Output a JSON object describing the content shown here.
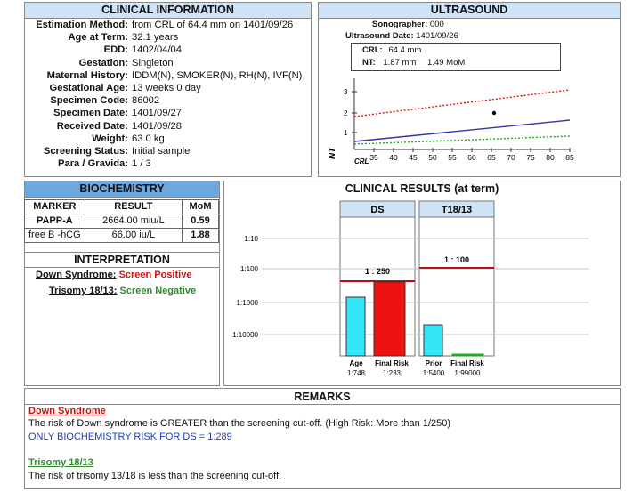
{
  "clinical_info": {
    "title": "CLINICAL INFORMATION",
    "rows": [
      {
        "label": "Estimation Method:",
        "value": "from CRL of 64.4 mm on 1401/09/26"
      },
      {
        "label": "Age at Term:",
        "value": "32.1 years"
      },
      {
        "label": "EDD:",
        "value": "1402/04/04"
      },
      {
        "label": "Gestation:",
        "value": "Singleton"
      },
      {
        "label": "Maternal History:",
        "value": "IDDM(N), SMOKER(N), RH(N), IVF(N)"
      },
      {
        "label": "Gestational Age:",
        "value": "13 weeks 0 day"
      },
      {
        "label": "Specimen Code:",
        "value": "86002"
      },
      {
        "label": "Specimen Date:",
        "value": "1401/09/27"
      },
      {
        "label": "Received Date:",
        "value": "1401/09/28"
      },
      {
        "label": "Weight:",
        "value": "63.0 kg"
      },
      {
        "label": "Screening Status:",
        "value": "Initial sample"
      },
      {
        "label": "Para / Gravida:",
        "value": "1 / 3"
      }
    ]
  },
  "ultrasound": {
    "title": "ULTRASOUND",
    "sonographer_label": "Sonographer:",
    "sonographer_value": "000",
    "date_label": "Ultrasound Date:",
    "date_value": "1401/09/26",
    "crl_label": "CRL:",
    "crl_value": "64.4 mm",
    "nt_label": "NT:",
    "nt_value": "1.87 mm",
    "nt_mom": "1.49 MoM",
    "y_axis_label": "NT",
    "x_axis_label": "CRL",
    "y_ticks": [
      "1",
      "2",
      "3"
    ],
    "x_ticks": [
      "35",
      "40",
      "45",
      "50",
      "55",
      "60",
      "65",
      "70",
      "75",
      "80",
      "85"
    ]
  },
  "biochemistry": {
    "title": "BIOCHEMISTRY",
    "headers": [
      "MARKER",
      "RESULT",
      "MoM"
    ],
    "rows": [
      {
        "marker": "PAPP-A",
        "result": "2664.00 miu/L",
        "mom": "0.59"
      },
      {
        "marker": "free B -hCG",
        "result": "66.00 iu/L",
        "mom": "1.88"
      }
    ]
  },
  "interpretation": {
    "title": "INTERPRETATION",
    "ds_label": "Down Syndrome:",
    "ds_value": "Screen  Positive",
    "t18_label": "Trisomy 18/13:",
    "t18_value": "Screen Negative"
  },
  "clinical_results": {
    "title": "CLINICAL RESULTS (at term)",
    "ds_header": "DS",
    "t18_header": "T18/13",
    "ds_cutoff_label": "1 : 250",
    "t18_cutoff_label": "1 : 100",
    "y_ticks": [
      "1:10",
      "1:100",
      "1:1000",
      "1:10000"
    ],
    "bars": [
      {
        "label": "Age",
        "value": "1:748"
      },
      {
        "label": "Final Risk",
        "value": "1:233"
      },
      {
        "label": "Prior",
        "value": "1:5400"
      },
      {
        "label": "Final Risk",
        "value": "1:99000"
      }
    ]
  },
  "remarks": {
    "title": "REMARKS",
    "ds_heading": "Down Syndrome",
    "ds_text": "The risk of Down syndrome is GREATER than the screening cut-off. (High Risk: More than 1/250)",
    "ds_note": "ONLY BIOCHEMISTRY RISK FOR DS = 1:289",
    "t18_heading": "Trisomy 18/13",
    "t18_text": "The risk of trisomy 13/18 is less than the screening cut-off."
  },
  "colors": {
    "header_light": "#cfe3f7",
    "header_dark": "#6fa8dc",
    "cyan_bar": "#33e5f5",
    "red_bar": "#ee1111",
    "positive": "#cc1111",
    "negative": "#2e8b2e",
    "note_blue": "#1a3cc9"
  }
}
